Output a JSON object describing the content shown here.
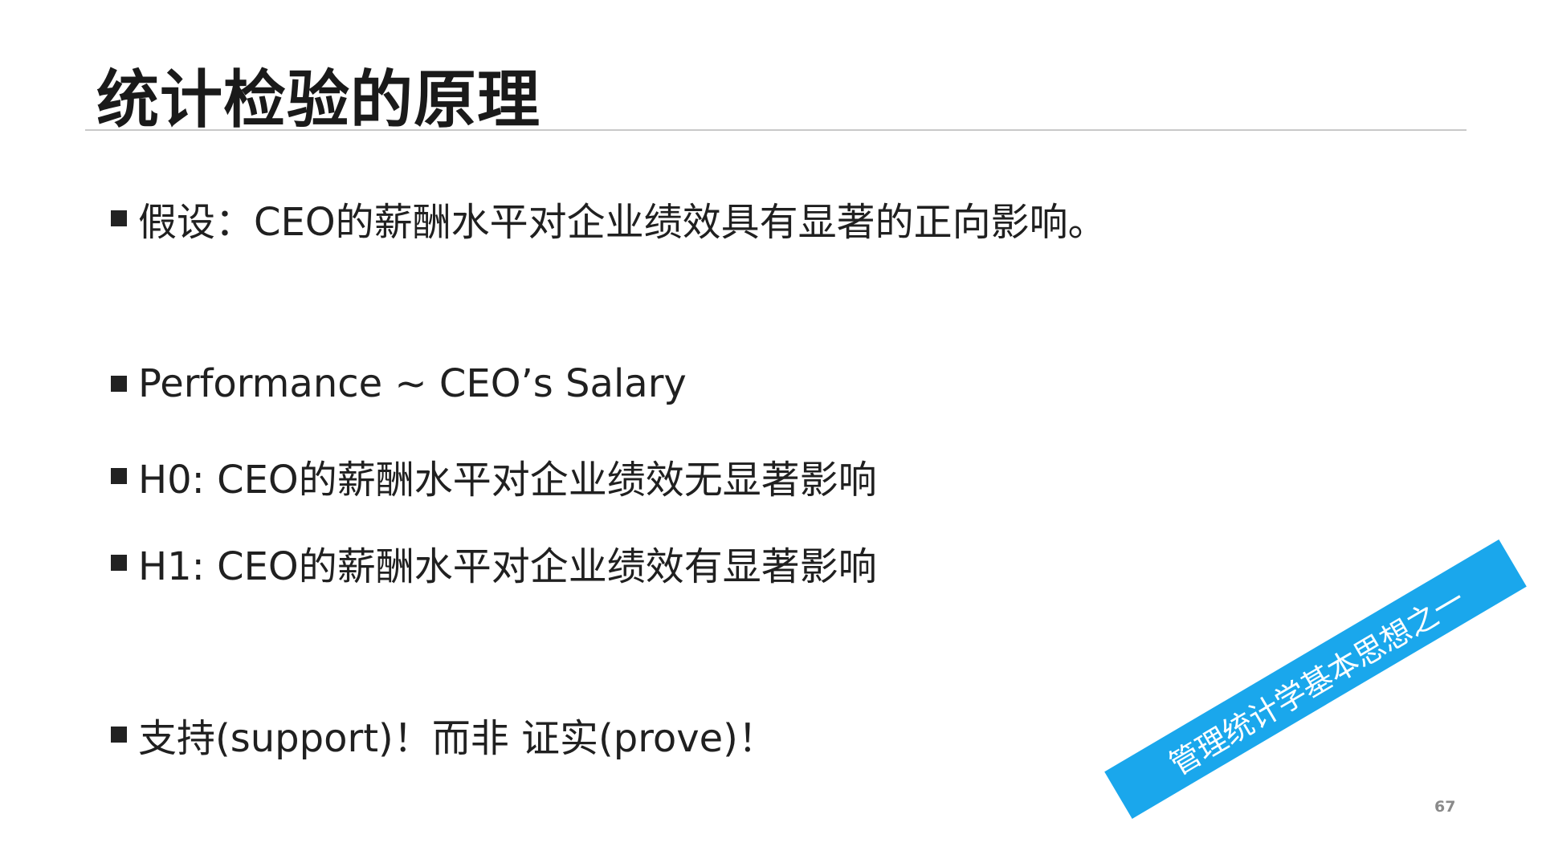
{
  "slide": {
    "title": "统计检验的原理",
    "bullets": [
      "假设：CEO的薪酬水平对企业绩效具有显著的正向影响。",
      "Performance ~ CEO’s Salary",
      "H0: CEO的薪酬水平对企业绩效无显著影响",
      "H1: CEO的薪酬水平对企业绩效有显著影响",
      "支持(support)！而非 证实(prove)！"
    ],
    "banner": "管理统计学基本思想之一",
    "page_number": "67"
  },
  "colors": {
    "banner_bg": "#1aa7ec",
    "title_text": "#1a1a1a",
    "body_text": "#202020",
    "divider": "#c8c8c8"
  }
}
